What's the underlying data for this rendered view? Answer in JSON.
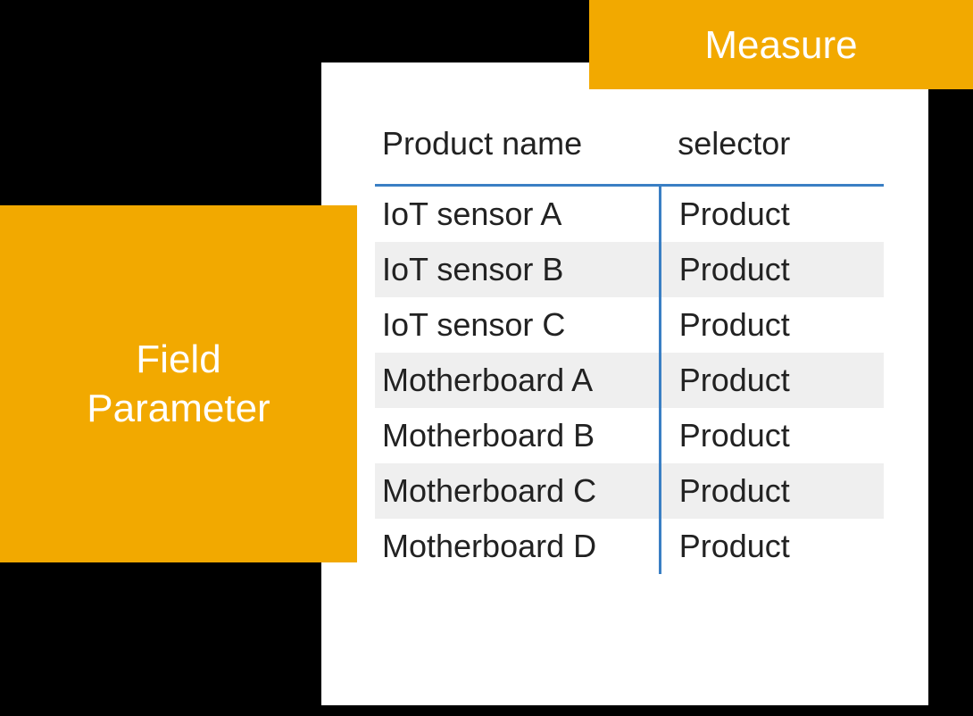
{
  "labels": {
    "measure": "Measure",
    "field_parameter": "Field\nParameter"
  },
  "table": {
    "columns": {
      "product": "Product name",
      "selector": "selector"
    },
    "rows": [
      {
        "product": "IoT sensor A",
        "selector": "Product"
      },
      {
        "product": "IoT sensor B",
        "selector": "Product"
      },
      {
        "product": "IoT sensor C",
        "selector": "Product"
      },
      {
        "product": "Motherboard A",
        "selector": "Product"
      },
      {
        "product": "Motherboard B",
        "selector": "Product"
      },
      {
        "product": "Motherboard C",
        "selector": "Product"
      },
      {
        "product": "Motherboard D",
        "selector": "Product"
      }
    ]
  },
  "colors": {
    "accent": "#f2a900",
    "rule": "#3a7fc4"
  }
}
